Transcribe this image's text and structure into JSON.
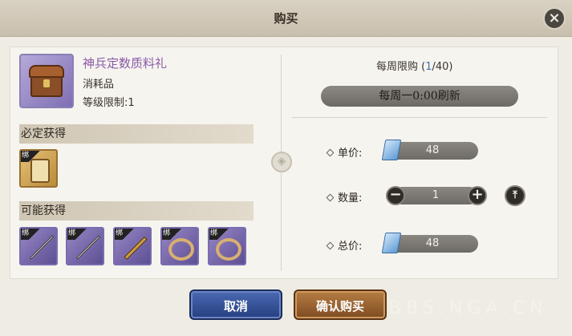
{
  "dialog": {
    "title": "购买"
  },
  "item": {
    "name": "神兵定数质料礼",
    "type": "消耗品",
    "level_limit": "等级限制:1"
  },
  "sections": {
    "guaranteed": "必定获得",
    "possible": "可能获得"
  },
  "bind_tag": "绑",
  "weekly": {
    "label_prefix": "每周限购 (",
    "count": "1",
    "label_suffix": "/40)",
    "refresh": "每周一0:00刷新"
  },
  "purchase": {
    "unit_price_label": "单价:",
    "unit_price": "48",
    "quantity_label": "数量:",
    "quantity": "1",
    "total_label": "总价:",
    "total": "48"
  },
  "buttons": {
    "cancel": "取消",
    "confirm": "确认购买"
  },
  "watermark": "BBS.NGA.CN",
  "icons": {
    "close": "close-icon",
    "minus": "minus-icon",
    "plus": "plus-icon",
    "max": "max-icon",
    "currency": "gem-currency-icon"
  },
  "colors": {
    "item_name": "#8a5aa8",
    "cancel_button": "#253f80",
    "confirm_button": "#7e4b20",
    "limit_highlight": "#3a6fb0"
  }
}
